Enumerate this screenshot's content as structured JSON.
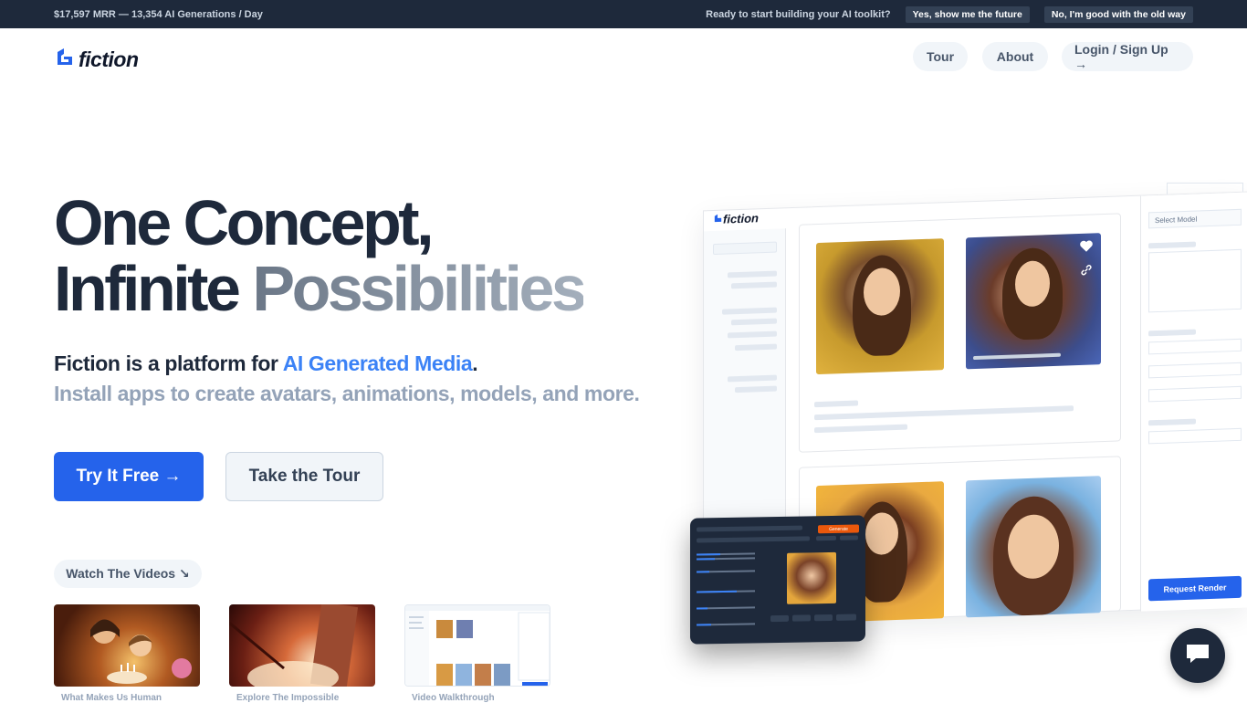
{
  "topbar": {
    "stats": "$17,597 MRR — 13,354 AI Generations / Day",
    "question": "Ready to start building your AI toolkit?",
    "yes_label": "Yes, show me the future",
    "no_label": "No, I'm good with the old way"
  },
  "nav": {
    "logo_text": "fiction",
    "tour": "Tour",
    "about": "About",
    "login": "Login / Sign Up →"
  },
  "hero": {
    "title_line1": "One Concept,",
    "title_line2a": "Infinite ",
    "title_line2b": "Possibilities",
    "sub1_prefix": "Fiction is a platform for ",
    "sub1_highlight": "AI Generated Media",
    "sub1_suffix": ".",
    "sub2": "Install apps to create avatars, animations, models, and more.",
    "cta_primary": "Try It Free →",
    "cta_secondary": "Take the Tour"
  },
  "videos": {
    "pill": "Watch The Videos ↘",
    "items": [
      {
        "label": "What Makes Us Human"
      },
      {
        "label": "Explore The Impossible"
      },
      {
        "label": "Video Walkthrough"
      }
    ]
  },
  "mockup": {
    "logo_text": "fiction",
    "select_model": "Select Model",
    "request_render": "Request Render",
    "generate": "Generate"
  },
  "colors": {
    "primary": "#2563eb",
    "accent_text": "#3b82f6",
    "dark": "#1e293b",
    "muted": "#94a3b8"
  },
  "icons": {
    "logo": "fiction-logo-icon",
    "heart": "heart-icon",
    "link": "link-icon",
    "chat": "chat-icon"
  }
}
